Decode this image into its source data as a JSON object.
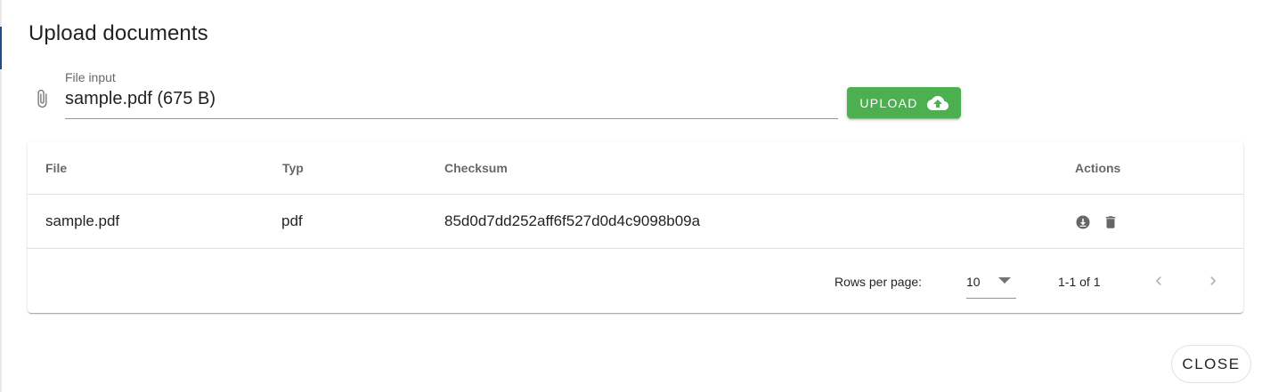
{
  "dialog": {
    "title": "Upload documents"
  },
  "file_input": {
    "label": "File input",
    "value": "sample.pdf (675 B)",
    "icon": "paperclip-icon"
  },
  "upload_button": {
    "label": "UPLOAD",
    "icon": "cloud-upload-icon",
    "color": "#4caf50"
  },
  "table": {
    "columns": [
      "File",
      "Typ",
      "Checksum",
      "Actions"
    ],
    "rows": [
      {
        "file": "sample.pdf",
        "type": "pdf",
        "checksum": "85d0d7dd252aff6f527d0d4c9098b09a",
        "actions": [
          "download-icon",
          "delete-icon"
        ]
      }
    ],
    "footer": {
      "rows_per_page_label": "Rows per page:",
      "rows_per_page_value": "10",
      "page_info": "1-1 of 1"
    }
  },
  "close_button": {
    "label": "CLOSE"
  }
}
